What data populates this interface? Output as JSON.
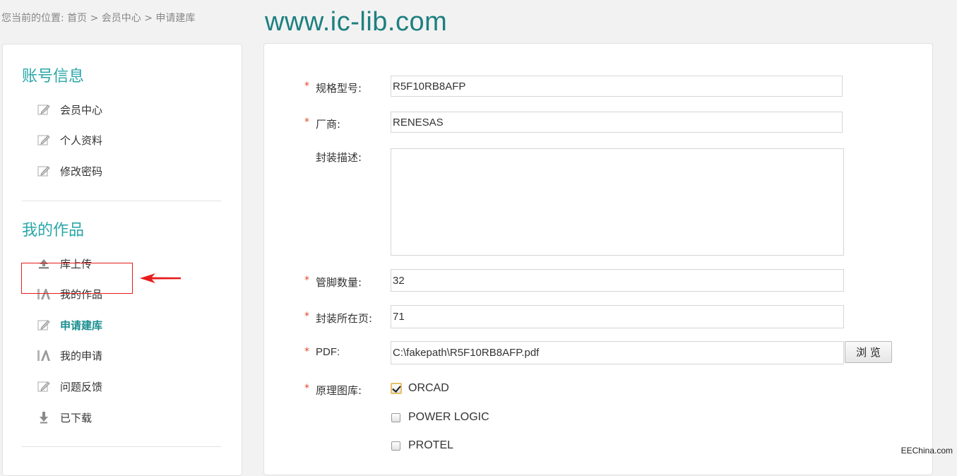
{
  "breadcrumb": "您当前的位置: 首页 > 会员中心 > 申请建库",
  "watermark_top": "www.ic-lib.com",
  "watermark_bottom": "EEChina.com",
  "sidebar": {
    "account_title": "账号信息",
    "account_items": [
      {
        "label": "会员中心",
        "icon": "edit-icon"
      },
      {
        "label": "个人资料",
        "icon": "edit-icon"
      },
      {
        "label": "修改密码",
        "icon": "edit-icon"
      }
    ],
    "works_title": "我的作品",
    "works_items": [
      {
        "label": "库上传",
        "icon": "upload-icon"
      },
      {
        "label": "我的作品",
        "icon": "chart-icon"
      },
      {
        "label": "申请建库",
        "icon": "edit-icon",
        "active": true
      },
      {
        "label": "我的申请",
        "icon": "chart-icon"
      },
      {
        "label": "问题反馈",
        "icon": "edit-icon"
      },
      {
        "label": "已下载",
        "icon": "download-icon"
      }
    ]
  },
  "form": {
    "required_mark": "*",
    "part_number_label": "规格型号:",
    "part_number_value": "R5F10RB8AFP",
    "manufacturer_label": "厂商:",
    "manufacturer_value": "RENESAS",
    "package_desc_label": "封装描述:",
    "package_desc_value": "",
    "pin_count_label": "管脚数量:",
    "pin_count_value": "32",
    "package_page_label": "封装所在页:",
    "package_page_value": "71",
    "pdf_label": "PDF:",
    "pdf_value": "C:\\fakepath\\R5F10RB8AFP.pdf",
    "browse_label": "浏 览",
    "schematic_label": "原理图库:",
    "schematic_options": [
      {
        "label": "ORCAD",
        "checked": true
      },
      {
        "label": "POWER LOGIC",
        "checked": false
      },
      {
        "label": "PROTEL",
        "checked": false
      }
    ]
  },
  "colors": {
    "accent": "#2aa6a8",
    "required": "#e0492d",
    "highlight": "#e81c1c"
  }
}
